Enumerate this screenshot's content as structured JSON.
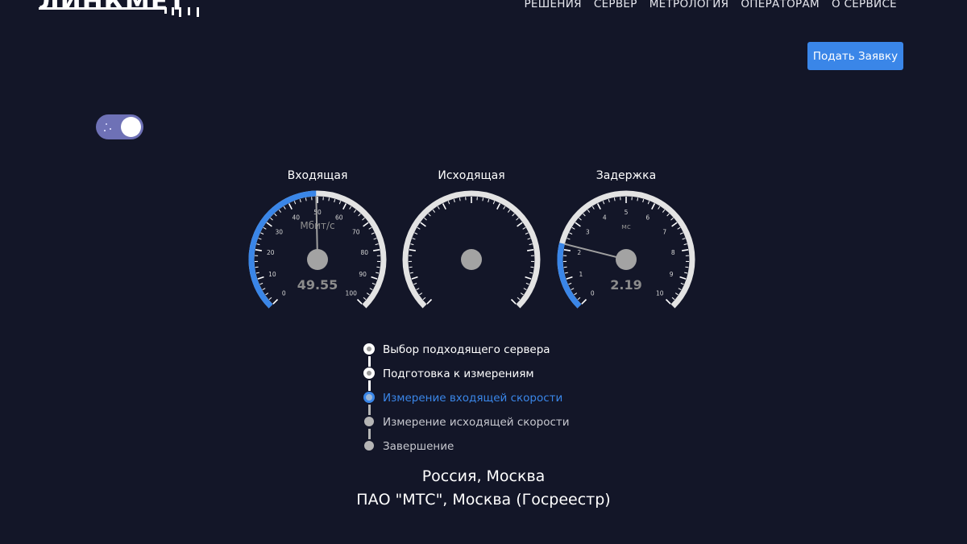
{
  "logo": {
    "text": "ЛИНКМЕТ"
  },
  "nav": {
    "items": [
      "РЕШЕНИЯ",
      "СЕРВЕР",
      "МЕТРОЛОГИЯ",
      "ОПЕРАТОРАМ",
      "О СЕРВИСЕ"
    ]
  },
  "cta": {
    "label": "Подать Заявку"
  },
  "theme_toggle": {
    "state": "on"
  },
  "gauges": [
    {
      "title": "Входящая",
      "unit": "Мбит/с",
      "value": "49.55",
      "value_num": 49.55,
      "min": 0,
      "max": 100,
      "ticks": [
        "0",
        "10",
        "20",
        "30",
        "40",
        "50",
        "60",
        "70",
        "80",
        "90",
        "100"
      ]
    },
    {
      "title": "Исходящая",
      "unit": "",
      "value": "",
      "ticks": []
    },
    {
      "title": "Задержка",
      "unit": "мс",
      "value": "2.19",
      "value_num": 2.19,
      "min": 0,
      "max": 10,
      "ticks": [
        "0",
        "1",
        "2",
        "3",
        "4",
        "5",
        "6",
        "7",
        "8",
        "9",
        "10"
      ]
    }
  ],
  "steps": [
    {
      "label": "Выбор подходящего сервера",
      "state": "done"
    },
    {
      "label": "Подготовка к измерениям",
      "state": "done"
    },
    {
      "label": "Измерение входящей скорости",
      "state": "active"
    },
    {
      "label": "Измерение исходящей скорости",
      "state": "pending"
    },
    {
      "label": "Завершение",
      "state": "pending"
    }
  ],
  "location": {
    "region": "Россия, Москва",
    "server": "ПАО \"МТС\", Москва (Госреестр)"
  },
  "colors": {
    "background": "#131628",
    "accent": "#3a86e8",
    "gauge_track": "#e3e3e3",
    "needle": "#a0a0a0"
  }
}
